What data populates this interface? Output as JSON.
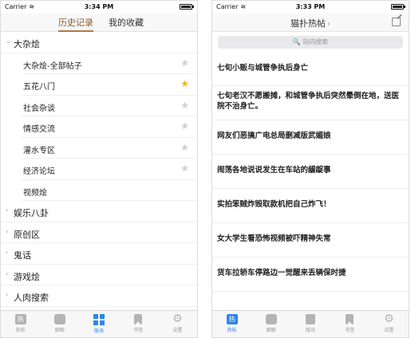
{
  "left": {
    "status": {
      "carrier": "Carrier",
      "time": "3:34 PM"
    },
    "segments": {
      "history": "历史记录",
      "favorites": "我的收藏"
    },
    "groups": [
      {
        "label": "大杂烩",
        "expanded": true
      },
      {
        "label": "娱乐八卦"
      },
      {
        "label": "原创区"
      },
      {
        "label": "鬼话"
      },
      {
        "label": "游戏烩"
      },
      {
        "label": "人肉搜索"
      }
    ],
    "sub_items": [
      {
        "label": "大杂烩-全部帖子",
        "starred": false
      },
      {
        "label": "五花八门",
        "starred": true
      },
      {
        "label": "社会杂谈",
        "starred": false
      },
      {
        "label": "情感交流",
        "starred": false
      },
      {
        "label": "灌水专区",
        "starred": false
      },
      {
        "label": "经济论坛",
        "starred": false
      },
      {
        "label": "视频烩",
        "starred": false
      }
    ],
    "tabs": [
      {
        "label": "热帖",
        "icon": "hot-icon"
      },
      {
        "label": "聊聊",
        "icon": "chat-icon"
      },
      {
        "label": "版块",
        "icon": "blocks-icon",
        "active": true
      },
      {
        "label": "书签",
        "icon": "bookmark-icon"
      },
      {
        "label": "设置",
        "icon": "gear-icon"
      }
    ]
  },
  "right": {
    "status": {
      "carrier": "Carrier",
      "time": "3:33 PM"
    },
    "title": "猫扑热帖",
    "chevron": "›",
    "search": {
      "placeholder": "站内搜索"
    },
    "posts": [
      "七旬小贩与城管争执后身亡",
      "七旬老汉不愿搬摊，和城管争执后突然晕倒在地，送医院不治身亡。",
      "网友们恶搞广电总局删减版武媚娘",
      "闹荡各地说说发生在车站的龌龊事",
      "实拍笨贼炸毁取款机把自己炸飞！",
      "女大学生看恐怖视频被吓精神失常",
      "货车拉轿车停路边一觉醒来丢辆保时捷"
    ],
    "tabs": [
      {
        "label": "热帖",
        "icon": "hot-icon",
        "active": true
      },
      {
        "label": "聊聊",
        "icon": "chat-icon"
      },
      {
        "label": "版块",
        "icon": "blocks-icon"
      },
      {
        "label": "书签",
        "icon": "bookmark-icon"
      },
      {
        "label": "设置",
        "icon": "gear-icon"
      }
    ]
  },
  "colors": {
    "accent": "#2f86e8",
    "segment_active": "#8a5a2b",
    "star_on": "#f3b61f"
  }
}
